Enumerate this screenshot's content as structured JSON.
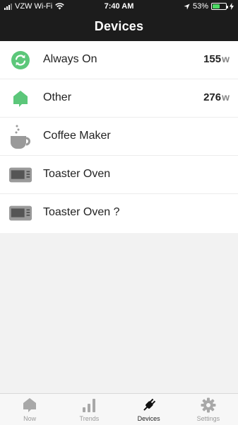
{
  "status_bar": {
    "carrier": "VZW Wi-Fi",
    "time": "7:40 AM",
    "battery_percent": "53%",
    "battery_level": 0.53,
    "icons": [
      "signal-icon",
      "wifi-icon",
      "location-arrow-icon",
      "battery-icon",
      "charging-bolt-icon"
    ]
  },
  "header": {
    "title": "Devices"
  },
  "devices": [
    {
      "name": "Always On",
      "value": "155",
      "unit": "w",
      "icon": "always-on-icon"
    },
    {
      "name": "Other",
      "value": "276",
      "unit": "w",
      "icon": "other-home-icon"
    },
    {
      "name": "Coffee Maker",
      "icon": "coffee-cup-icon"
    },
    {
      "name": "Toaster Oven",
      "icon": "toaster-oven-icon"
    },
    {
      "name": "Toaster Oven ?",
      "icon": "toaster-oven-icon"
    }
  ],
  "colors": {
    "accent_green": "#5cc77a",
    "header_bg": "#1c1c1c",
    "device_gray": "#9a9a9a"
  },
  "tabs": [
    {
      "label": "Now",
      "icon": "now-icon",
      "active": false
    },
    {
      "label": "Trends",
      "icon": "trends-bars-icon",
      "active": false
    },
    {
      "label": "Devices",
      "icon": "plug-icon",
      "active": true
    },
    {
      "label": "Settings",
      "icon": "gear-icon",
      "active": false
    }
  ]
}
